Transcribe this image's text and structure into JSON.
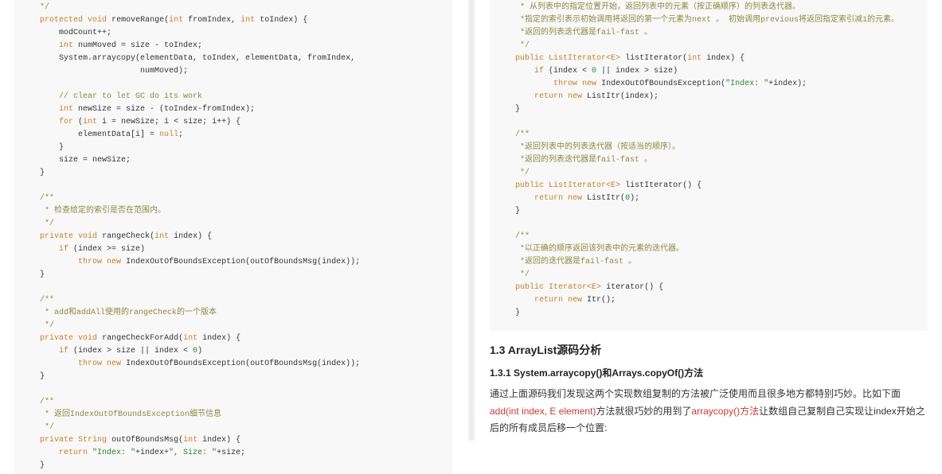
{
  "left": {
    "code": {
      "l1": "    */",
      "l2_kw1": "    protected",
      "l2_kw2": "void",
      "l2_fn": "removeRange",
      "l2_kw3": "int",
      "l2_p1": "fromIndex,",
      "l2_kw4": "int",
      "l2_p2": "toIndex) {",
      "l3": "        modCount++;",
      "l4_kw": "        int",
      "l4_rest": " numMoved = size - toIndex;",
      "l5": "        System.arraycopy(elementData, toIndex, elementData, fromIndex,",
      "l6": "                         numMoved);",
      "l7": "",
      "l8": "        // clear to let GC do its work",
      "l9_kw": "        int",
      "l9_rest": " newSize = size - (toIndex-fromIndex);",
      "l10_kw1": "        for",
      "l10_o": " (",
      "l10_kw2": "int",
      "l10_rest": " i = newSize; i < size; i++) {",
      "l11_a": "            elementData[i] = ",
      "l11_kw": "null",
      "l11_b": ";",
      "l12": "        }",
      "l13": "        size = newSize;",
      "l14": "    }",
      "l15": "",
      "l16": "    /**",
      "l17": "     * 检查给定的索引是否在范围内。",
      "l18": "     */",
      "l19_kw1": "    private",
      "l19_kw2": "void",
      "l19_fn": "rangeCheck",
      "l19_kw3": "int",
      "l19_rest": " index) {",
      "l20_kw": "        if",
      "l20_rest": " (index >= size)",
      "l21_kw1": "            throw",
      "l21_kw2": "new",
      "l21_rest": " IndexOutOfBoundsException(outOfBoundsMsg(index));",
      "l22": "    }",
      "l23": "",
      "l24": "    /**",
      "l25": "     * add和addAll使用的rangeCheck的一个版本",
      "l26": "     */",
      "l27_kw1": "    private",
      "l27_kw2": "void",
      "l27_fn": "rangeCheckForAdd",
      "l27_kw3": "int",
      "l27_rest": " index) {",
      "l28_kw": "        if",
      "l28_a": " (index > size || index < ",
      "l28_n": "0",
      "l28_b": ")",
      "l29_kw1": "            throw",
      "l29_kw2": "new",
      "l29_rest": " IndexOutOfBoundsException(outOfBoundsMsg(index));",
      "l30": "    }",
      "l31": "",
      "l32": "    /**",
      "l33": "     * 返回IndexOutOfBoundsException细节信息",
      "l34": "     */",
      "l35_kw1": "    private",
      "l35_type": "String",
      "l35_fn": "outOfBoundsMsg",
      "l35_kw2": "int",
      "l35_rest": " index) {",
      "l36_kw": "        return",
      "l36_s1": " \"Index: \"",
      "l36_a": "+index+",
      "l36_s2": "\", Size: \"",
      "l36_b": "+size;",
      "l37": "    }"
    }
  },
  "right": {
    "code": {
      "r1": "     * 从列表中的指定位置开始，返回列表中的元素（按正确顺序）的列表迭代器。",
      "r2": "     *指定的索引表示初始调用将返回的第一个元素为next 。 初始调用previous将返回指定索引减1的元素。",
      "r3": "     *返回的列表迭代器是fail-fast 。",
      "r4": "     */",
      "r5_kw1": "    public",
      "r5_type": "ListIterator<E>",
      "r5_fn": "listIterator",
      "r5_kw2": "int",
      "r5_rest": " index) {",
      "r6_kw": "        if",
      "r6_a": " (index < ",
      "r6_n1": "0",
      "r6_b": " || index > size)",
      "r7_kw1": "            throw",
      "r7_kw2": "new",
      "r7_a": " IndexOutOfBoundsException(",
      "r7_s": "\"Index: \"",
      "r7_b": "+index);",
      "r8_kw1": "        return",
      "r8_kw2": "new",
      "r8_rest": " ListItr(index);",
      "r9": "    }",
      "r10": "",
      "r11": "    /**",
      "r12": "     *返回列表中的列表迭代器（按适当的顺序）。",
      "r13": "     *返回的列表迭代器是fail-fast 。",
      "r14": "     */",
      "r15_kw1": "    public",
      "r15_type": "ListIterator<E>",
      "r15_fn": "listIterator",
      "r15_rest": "() {",
      "r16_kw1": "        return",
      "r16_kw2": "new",
      "r16_a": " ListItr(",
      "r16_n": "0",
      "r16_b": ");",
      "r17": "    }",
      "r18": "",
      "r19": "    /**",
      "r20": "     *以正确的顺序返回该列表中的元素的迭代器。",
      "r21": "     *返回的迭代器是fail-fast 。",
      "r22": "     */",
      "r23_kw1": "    public",
      "r23_type": "Iterator<E>",
      "r23_fn": "iterator",
      "r23_rest": "() {",
      "r24_kw1": "        return",
      "r24_kw2": "new",
      "r24_rest": " Itr();",
      "r25": "    }"
    },
    "h2": "1.3 ArrayList源码分析",
    "h3": "1.3.1 System.arraycopy()和Arrays.copyOf()方法",
    "p1a": "通过上面源码我们发现这两个实现数组复制的方法被广泛使用而且很多地方都特别巧妙。比如下面",
    "p1b": "add(int index, E element)",
    "p1c": "方法就很巧妙的用到了",
    "p1d": "arraycopy()方法",
    "p1e": "让数组自己复制自己实现让index开始之后的所有成员后移一个位置:"
  }
}
